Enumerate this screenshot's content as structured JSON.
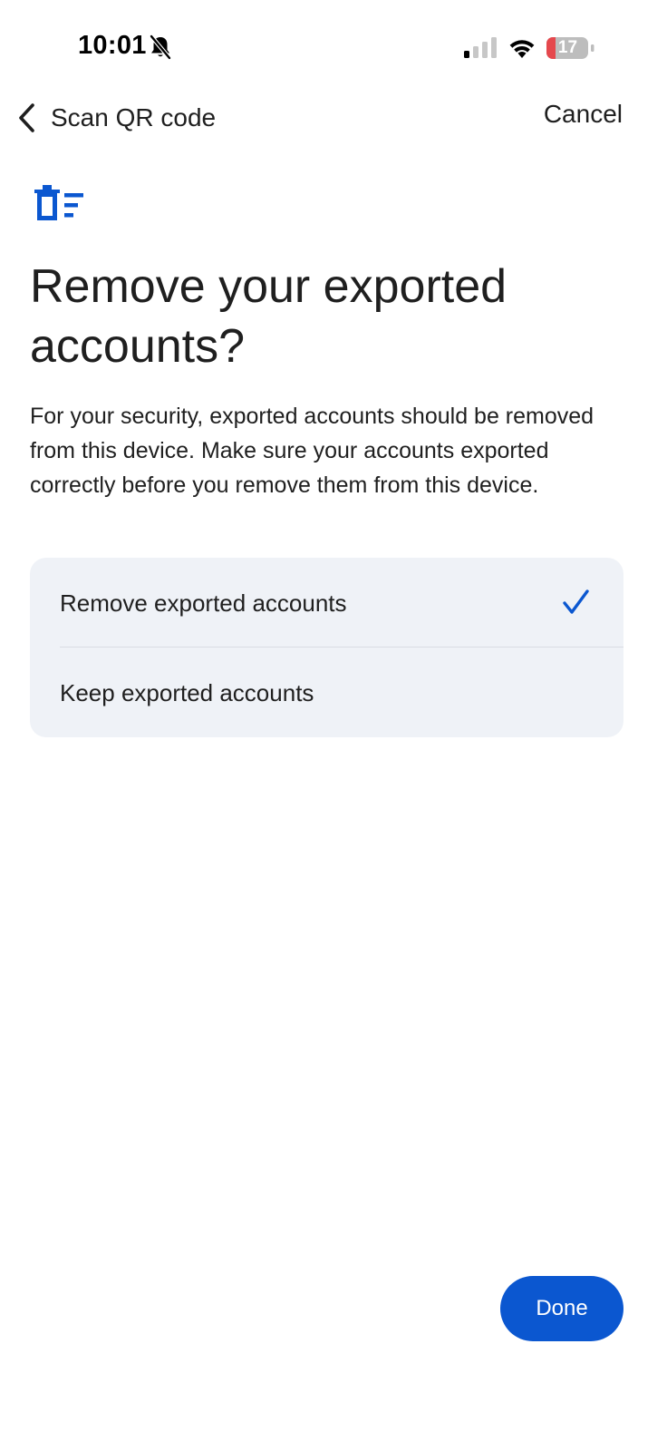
{
  "status_bar": {
    "time": "10:01",
    "battery_level": "17",
    "signal_icon": "cellular-signal-icon",
    "wifi_icon": "wifi-icon",
    "silent_icon": "bell-off-icon",
    "battery_color": "#e5484d"
  },
  "nav": {
    "back_label": "Scan QR code",
    "back_icon": "chevron-left-icon",
    "cancel_label": "Cancel"
  },
  "content": {
    "icon": "delete-list-icon",
    "title": "Remove your exported accounts?",
    "description": "For your security, exported accounts should be removed from this device. Make sure your accounts exported correctly before you remove them from this device."
  },
  "options": [
    {
      "label": "Remove exported accounts",
      "selected": true
    },
    {
      "label": "Keep exported accounts",
      "selected": false
    }
  ],
  "done_label": "Done",
  "colors": {
    "accent": "#0b57d0",
    "card_background": "#eff2f7",
    "text": "#1f1f1f"
  }
}
